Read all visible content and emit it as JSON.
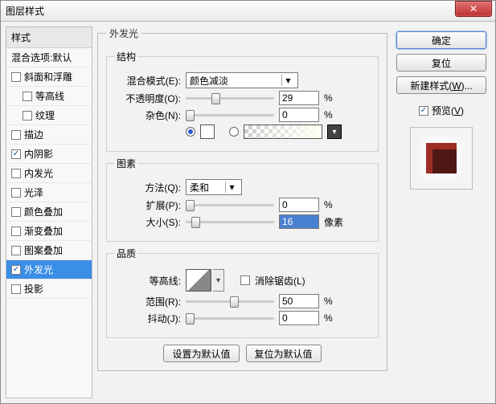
{
  "window": {
    "title": "图层样式",
    "close": "✕"
  },
  "sidebar": {
    "header": "样式",
    "blend_defaults": "混合选项:默认",
    "items": [
      {
        "label": "斜面和浮雕",
        "checked": false,
        "sub": false
      },
      {
        "label": "等高线",
        "checked": false,
        "sub": true
      },
      {
        "label": "纹理",
        "checked": false,
        "sub": true
      },
      {
        "label": "描边",
        "checked": false,
        "sub": false
      },
      {
        "label": "内阴影",
        "checked": true,
        "sub": false
      },
      {
        "label": "内发光",
        "checked": false,
        "sub": false
      },
      {
        "label": "光泽",
        "checked": false,
        "sub": false
      },
      {
        "label": "颜色叠加",
        "checked": false,
        "sub": false
      },
      {
        "label": "渐变叠加",
        "checked": false,
        "sub": false
      },
      {
        "label": "图案叠加",
        "checked": false,
        "sub": false
      },
      {
        "label": "外发光",
        "checked": true,
        "sub": false,
        "selected": true
      },
      {
        "label": "投影",
        "checked": false,
        "sub": false
      }
    ]
  },
  "panel": {
    "title": "外发光",
    "structure": {
      "groupTitle": "结构",
      "blendMode": {
        "label": "混合模式(E):",
        "value": "颜色减淡"
      },
      "opacity": {
        "label": "不透明度(O):",
        "value": "29",
        "unit": "%",
        "pos": 29
      },
      "noise": {
        "label": "杂色(N):",
        "value": "0",
        "unit": "%",
        "pos": 0
      },
      "colorRadioOn": true
    },
    "elements": {
      "groupTitle": "图素",
      "technique": {
        "label": "方法(Q):",
        "value": "柔和"
      },
      "spread": {
        "label": "扩展(P):",
        "value": "0",
        "unit": "%",
        "pos": 0
      },
      "size": {
        "label": "大小(S):",
        "value": "16",
        "unit": "像素",
        "pos": 6,
        "selected": true
      }
    },
    "quality": {
      "groupTitle": "品质",
      "contourLabel": "等高线:",
      "antialias": {
        "label": "消除锯齿(L)",
        "checked": false
      },
      "range": {
        "label": "范围(R):",
        "value": "50",
        "unit": "%",
        "pos": 50
      },
      "jitter": {
        "label": "抖动(J):",
        "value": "0",
        "unit": "%",
        "pos": 0
      }
    },
    "defaults": {
      "set": "设置为默认值",
      "reset": "复位为默认值"
    }
  },
  "right": {
    "ok": "确定",
    "reset": "复位",
    "newStyle": "新建样式(W)...",
    "preview": {
      "label": "预览(V)",
      "checked": true
    }
  }
}
